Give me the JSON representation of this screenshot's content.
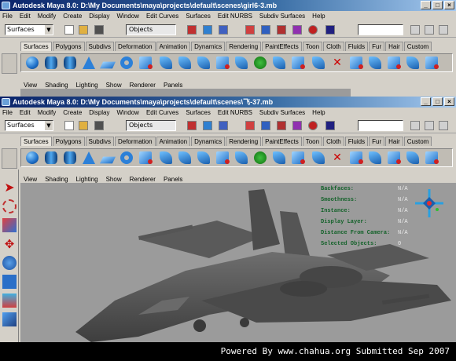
{
  "window1": {
    "title": "Autodesk Maya 8.0: D:\\My Documents\\maya\\projects\\default\\scenes\\girl6-3.mb",
    "menus": [
      "File",
      "Edit",
      "Modify",
      "Create",
      "Display",
      "Window",
      "Edit Curves",
      "Surfaces",
      "Edit NURBS",
      "Subdiv Surfaces",
      "Help"
    ],
    "mode": "Surfaces",
    "object_selector": "Objects",
    "shelf_tabs": [
      "Surfaces",
      "Polygons",
      "Subdivs",
      "Deformation",
      "Animation",
      "Dynamics",
      "Rendering",
      "PaintEffects",
      "Toon",
      "Cloth",
      "Fluids",
      "Fur",
      "Hair",
      "Custom"
    ],
    "panel_menus": [
      "View",
      "Shading",
      "Lighting",
      "Show",
      "Renderer",
      "Panels"
    ]
  },
  "window2": {
    "title": "Autodesk Maya 8.0: D:\\My Documents\\maya\\projects\\default\\scenes\\飞-37.mb",
    "menus": [
      "File",
      "Edit",
      "Modify",
      "Create",
      "Display",
      "Window",
      "Edit Curves",
      "Surfaces",
      "Edit NURBS",
      "Subdiv Surfaces",
      "Help"
    ],
    "mode": "Surfaces",
    "object_selector": "Objects",
    "shelf_tabs": [
      "Surfaces",
      "Polygons",
      "Subdivs",
      "Deformation",
      "Animation",
      "Dynamics",
      "Rendering",
      "PaintEffects",
      "Toon",
      "Cloth",
      "Fluids",
      "Fur",
      "Hair",
      "Custom"
    ],
    "panel_menus": [
      "View",
      "Shading",
      "Lighting",
      "Show",
      "Renderer",
      "Panels"
    ],
    "hud": [
      {
        "label": "Backfaces:",
        "value": "N/A"
      },
      {
        "label": "Smoothness:",
        "value": "N/A"
      },
      {
        "label": "Instance:",
        "value": "N/A"
      },
      {
        "label": "Display Layer:",
        "value": "N/A"
      },
      {
        "label": "Distance From Camera:",
        "value": "N/A"
      },
      {
        "label": "Selected Objects:",
        "value": "0"
      }
    ]
  },
  "footer": "Powered By www.chahua.org  Submitted Sep 2007",
  "colors": {
    "title_start": "#0a246a",
    "viewport_bg": "#9b9b9b",
    "hud_label": "#14622a"
  }
}
